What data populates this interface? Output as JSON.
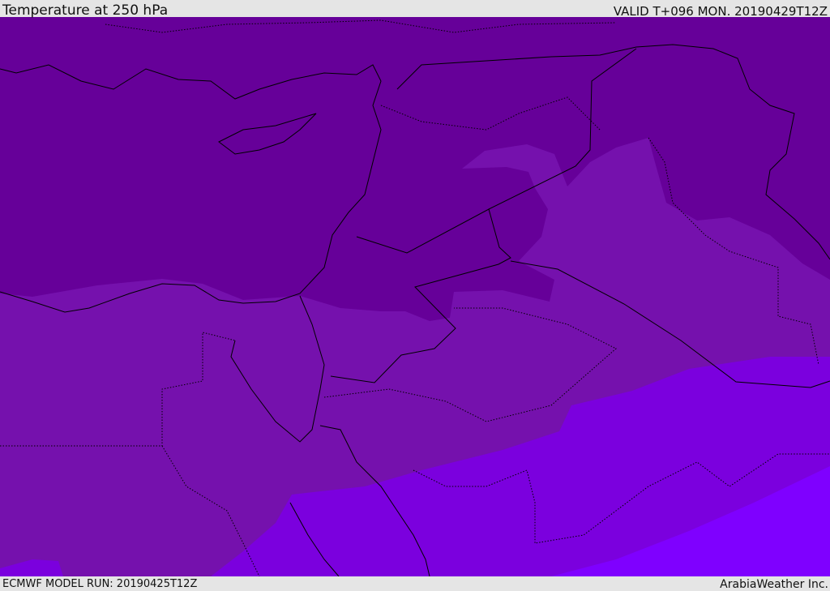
{
  "header": {
    "title": "Temperature at 250 hPa",
    "valid": "VALID T+096 MON. 20190429T12Z"
  },
  "footer": {
    "model_run": "ECMWF MODEL RUN: 20190425T12Z",
    "brand": "ArabiaWeather Inc."
  },
  "map": {
    "colors": {
      "band1": "#660099",
      "band2": "#7511ad",
      "band3": "#7b00de",
      "band4": "#7f00ff",
      "coast": "#000000"
    }
  }
}
